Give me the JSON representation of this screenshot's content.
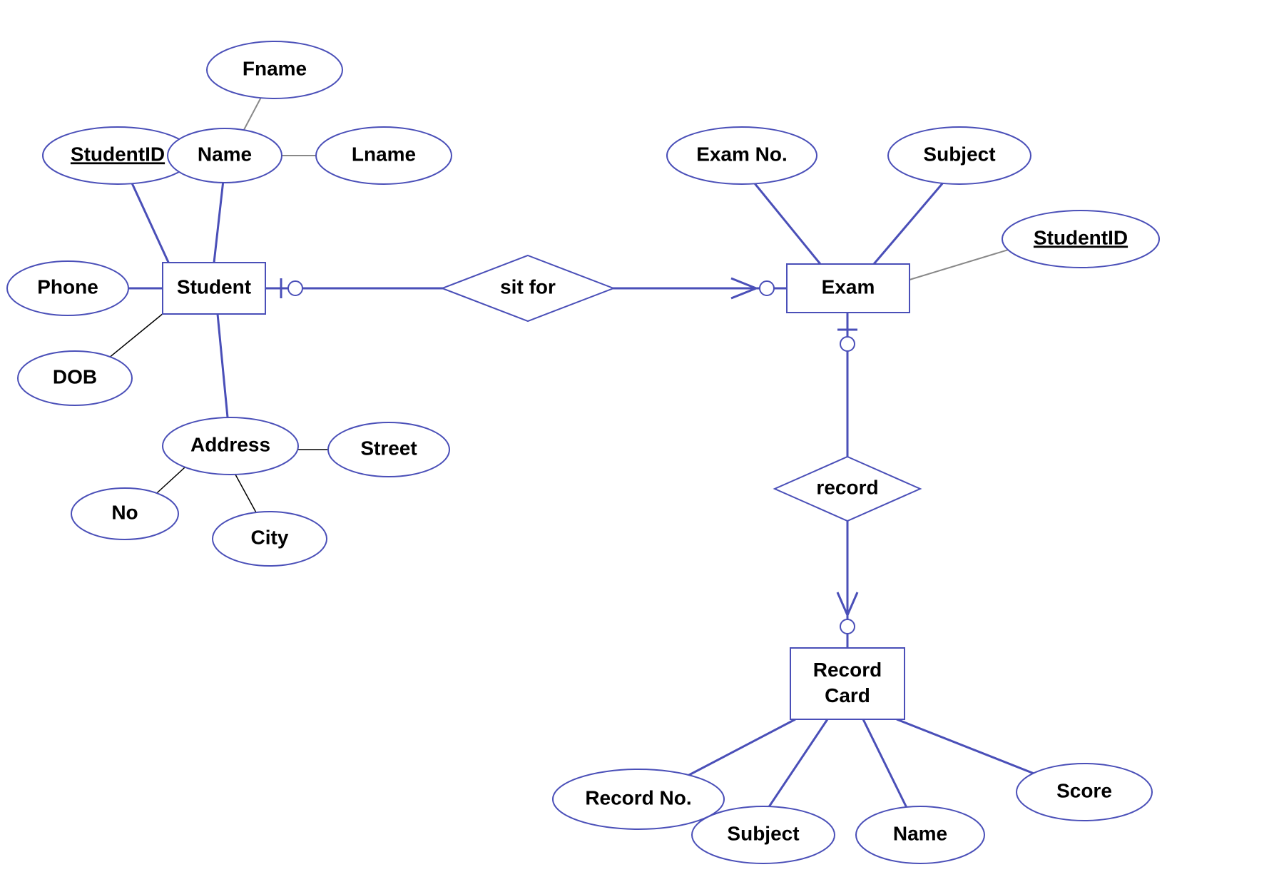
{
  "entities": {
    "student": "Student",
    "exam": "Exam",
    "record_card_l1": "Record",
    "record_card_l2": "Card"
  },
  "relationships": {
    "sit_for": "sit for",
    "record": "record"
  },
  "attributes": {
    "student_id": "StudentID",
    "name": "Name",
    "fname": "Fname",
    "lname": "Lname",
    "phone": "Phone",
    "dob": "DOB",
    "address": "Address",
    "no": "No",
    "city": "City",
    "street": "Street",
    "exam_no": "Exam No.",
    "subject_exam": "Subject",
    "exam_student_id": "StudentID",
    "record_no": "Record No.",
    "subject_rc": "Subject",
    "name_rc": "Name",
    "score": "Score"
  }
}
